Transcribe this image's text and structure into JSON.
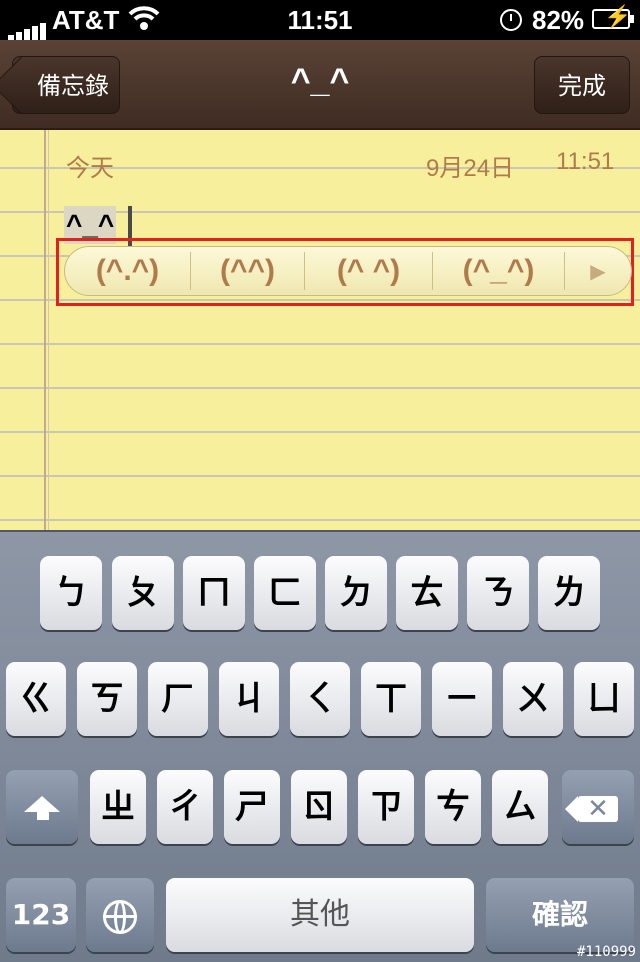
{
  "status": {
    "carrier": "AT&T",
    "time": "11:51",
    "battery": "82%"
  },
  "nav": {
    "back_label": "備忘錄",
    "title": "^_^",
    "done_label": "完成"
  },
  "note": {
    "date_label": "今天",
    "date": "9月24日",
    "time": "11:51",
    "text": "^_^"
  },
  "candidates": [
    "(^.^)",
    "(^^)",
    "(^ ^)",
    "(^_^)"
  ],
  "keyboard": {
    "row1": [
      "ㄅ",
      "ㄆ",
      "ㄇ",
      "ㄈ",
      "ㄉ",
      "ㄊ",
      "ㄋ",
      "ㄌ"
    ],
    "row2": [
      "ㄍ",
      "ㄎ",
      "ㄏ",
      "ㄐ",
      "ㄑ",
      "ㄒ",
      "ㄧ",
      "ㄨ",
      "ㄩ"
    ],
    "row3": [
      "ㄓ",
      "ㄔ",
      "ㄕ",
      "ㄖ",
      "ㄗ",
      "ㄘ",
      "ㄙ"
    ],
    "numbers_label": "123",
    "space_label": "其他",
    "confirm_label": "確認"
  },
  "watermark": "#110999"
}
